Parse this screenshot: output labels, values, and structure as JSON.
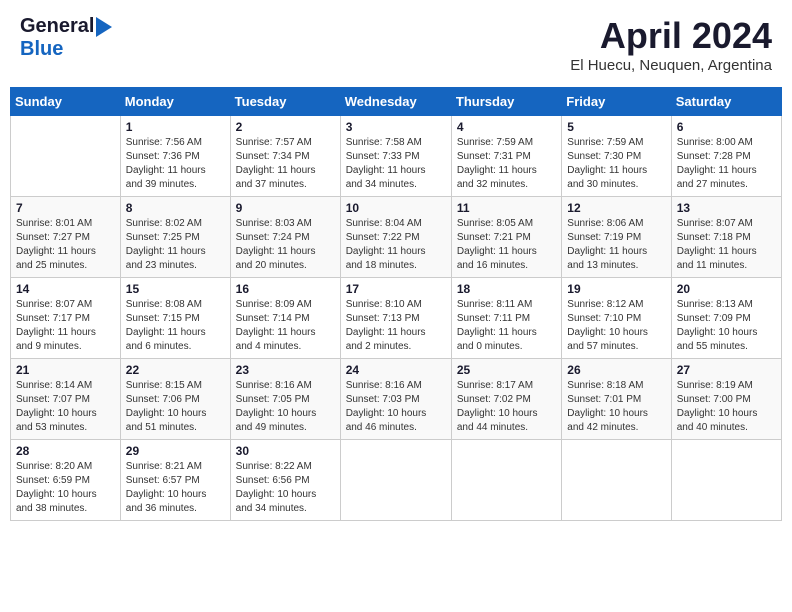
{
  "header": {
    "logo_general": "General",
    "logo_blue": "Blue",
    "month_title": "April 2024",
    "subtitle": "El Huecu, Neuquen, Argentina"
  },
  "calendar": {
    "days_of_week": [
      "Sunday",
      "Monday",
      "Tuesday",
      "Wednesday",
      "Thursday",
      "Friday",
      "Saturday"
    ],
    "weeks": [
      [
        {
          "day": "",
          "info": ""
        },
        {
          "day": "1",
          "info": "Sunrise: 7:56 AM\nSunset: 7:36 PM\nDaylight: 11 hours\nand 39 minutes."
        },
        {
          "day": "2",
          "info": "Sunrise: 7:57 AM\nSunset: 7:34 PM\nDaylight: 11 hours\nand 37 minutes."
        },
        {
          "day": "3",
          "info": "Sunrise: 7:58 AM\nSunset: 7:33 PM\nDaylight: 11 hours\nand 34 minutes."
        },
        {
          "day": "4",
          "info": "Sunrise: 7:59 AM\nSunset: 7:31 PM\nDaylight: 11 hours\nand 32 minutes."
        },
        {
          "day": "5",
          "info": "Sunrise: 7:59 AM\nSunset: 7:30 PM\nDaylight: 11 hours\nand 30 minutes."
        },
        {
          "day": "6",
          "info": "Sunrise: 8:00 AM\nSunset: 7:28 PM\nDaylight: 11 hours\nand 27 minutes."
        }
      ],
      [
        {
          "day": "7",
          "info": "Sunrise: 8:01 AM\nSunset: 7:27 PM\nDaylight: 11 hours\nand 25 minutes."
        },
        {
          "day": "8",
          "info": "Sunrise: 8:02 AM\nSunset: 7:25 PM\nDaylight: 11 hours\nand 23 minutes."
        },
        {
          "day": "9",
          "info": "Sunrise: 8:03 AM\nSunset: 7:24 PM\nDaylight: 11 hours\nand 20 minutes."
        },
        {
          "day": "10",
          "info": "Sunrise: 8:04 AM\nSunset: 7:22 PM\nDaylight: 11 hours\nand 18 minutes."
        },
        {
          "day": "11",
          "info": "Sunrise: 8:05 AM\nSunset: 7:21 PM\nDaylight: 11 hours\nand 16 minutes."
        },
        {
          "day": "12",
          "info": "Sunrise: 8:06 AM\nSunset: 7:19 PM\nDaylight: 11 hours\nand 13 minutes."
        },
        {
          "day": "13",
          "info": "Sunrise: 8:07 AM\nSunset: 7:18 PM\nDaylight: 11 hours\nand 11 minutes."
        }
      ],
      [
        {
          "day": "14",
          "info": "Sunrise: 8:07 AM\nSunset: 7:17 PM\nDaylight: 11 hours\nand 9 minutes."
        },
        {
          "day": "15",
          "info": "Sunrise: 8:08 AM\nSunset: 7:15 PM\nDaylight: 11 hours\nand 6 minutes."
        },
        {
          "day": "16",
          "info": "Sunrise: 8:09 AM\nSunset: 7:14 PM\nDaylight: 11 hours\nand 4 minutes."
        },
        {
          "day": "17",
          "info": "Sunrise: 8:10 AM\nSunset: 7:13 PM\nDaylight: 11 hours\nand 2 minutes."
        },
        {
          "day": "18",
          "info": "Sunrise: 8:11 AM\nSunset: 7:11 PM\nDaylight: 11 hours\nand 0 minutes."
        },
        {
          "day": "19",
          "info": "Sunrise: 8:12 AM\nSunset: 7:10 PM\nDaylight: 10 hours\nand 57 minutes."
        },
        {
          "day": "20",
          "info": "Sunrise: 8:13 AM\nSunset: 7:09 PM\nDaylight: 10 hours\nand 55 minutes."
        }
      ],
      [
        {
          "day": "21",
          "info": "Sunrise: 8:14 AM\nSunset: 7:07 PM\nDaylight: 10 hours\nand 53 minutes."
        },
        {
          "day": "22",
          "info": "Sunrise: 8:15 AM\nSunset: 7:06 PM\nDaylight: 10 hours\nand 51 minutes."
        },
        {
          "day": "23",
          "info": "Sunrise: 8:16 AM\nSunset: 7:05 PM\nDaylight: 10 hours\nand 49 minutes."
        },
        {
          "day": "24",
          "info": "Sunrise: 8:16 AM\nSunset: 7:03 PM\nDaylight: 10 hours\nand 46 minutes."
        },
        {
          "day": "25",
          "info": "Sunrise: 8:17 AM\nSunset: 7:02 PM\nDaylight: 10 hours\nand 44 minutes."
        },
        {
          "day": "26",
          "info": "Sunrise: 8:18 AM\nSunset: 7:01 PM\nDaylight: 10 hours\nand 42 minutes."
        },
        {
          "day": "27",
          "info": "Sunrise: 8:19 AM\nSunset: 7:00 PM\nDaylight: 10 hours\nand 40 minutes."
        }
      ],
      [
        {
          "day": "28",
          "info": "Sunrise: 8:20 AM\nSunset: 6:59 PM\nDaylight: 10 hours\nand 38 minutes."
        },
        {
          "day": "29",
          "info": "Sunrise: 8:21 AM\nSunset: 6:57 PM\nDaylight: 10 hours\nand 36 minutes."
        },
        {
          "day": "30",
          "info": "Sunrise: 8:22 AM\nSunset: 6:56 PM\nDaylight: 10 hours\nand 34 minutes."
        },
        {
          "day": "",
          "info": ""
        },
        {
          "day": "",
          "info": ""
        },
        {
          "day": "",
          "info": ""
        },
        {
          "day": "",
          "info": ""
        }
      ]
    ]
  }
}
